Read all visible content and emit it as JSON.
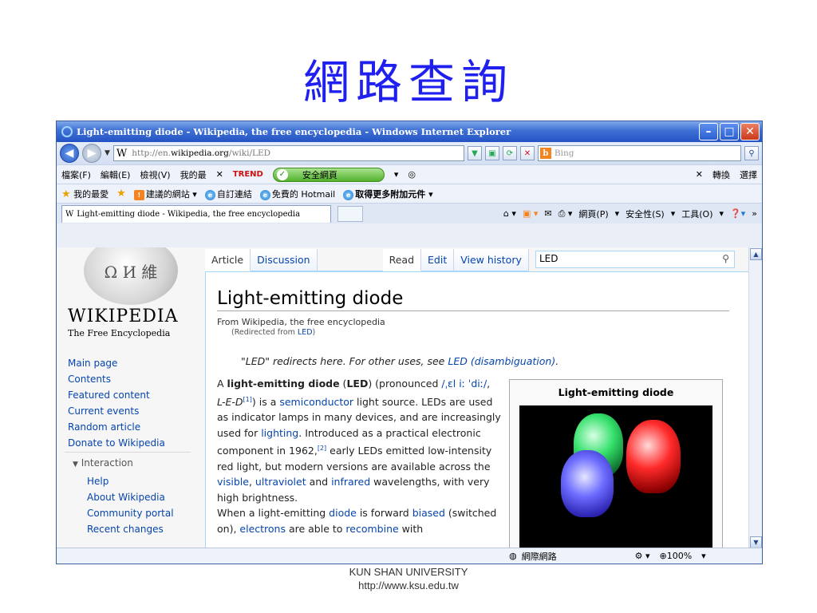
{
  "slide": {
    "title": "網路查詢",
    "footer_line1": "KUN SHAN UNIVERSITY",
    "footer_line2": "http://www.ksu.edu.tw"
  },
  "browser": {
    "window_title": "Light-emitting diode - Wikipedia, the free encyclopedia - Windows Internet Explorer",
    "address": {
      "prefix": "http://en.",
      "host": "wikipedia.org",
      "path": "/wiki/LED"
    },
    "search_placeholder": "Bing",
    "menu": {
      "file": "檔案(F)",
      "edit": "編輯(E)",
      "view": "檢視(V)",
      "favorites": "我的最",
      "trend": "TREND",
      "safe_page": "安全網頁",
      "translate": "轉換",
      "select": "選擇"
    },
    "favbar": {
      "favorites": "我的最愛",
      "suggested": "建議的網站",
      "custom_links": "自訂連結",
      "hotmail": "免費的 Hotmail",
      "more_addons": "取得更多附加元件"
    },
    "tab_label": "Light-emitting diode - Wikipedia, the free encyclopedia",
    "commands": {
      "page": "網頁(P)",
      "safety": "安全性(S)",
      "tools": "工具(O)"
    },
    "status": {
      "zone": "網際網路",
      "zoom": "100%"
    }
  },
  "wikipedia": {
    "wordmark": "WIKIPEDIA",
    "tagline": "The Free Encyclopedia",
    "nav": [
      "Main page",
      "Contents",
      "Featured content",
      "Current events",
      "Random article",
      "Donate to Wikipedia"
    ],
    "interaction_heading": "Interaction",
    "interaction": [
      "Help",
      "About Wikipedia",
      "Community portal",
      "Recent changes"
    ],
    "tabs": {
      "article": "Article",
      "discussion": "Discussion",
      "read": "Read",
      "edit": "Edit",
      "history": "View history"
    },
    "search_value": "LED",
    "article": {
      "title": "Light-emitting diode",
      "from": "From Wikipedia, the free encyclopedia",
      "redirect_prefix": "(Redirected from ",
      "redirect_link": "LED",
      "redirect_suffix": ")",
      "hatnote_text": "\"LED\" redirects here. For other uses, see ",
      "hatnote_link": "LED (disambiguation)",
      "hatnote_end": ".",
      "infobox_title": "Light-emitting diode"
    }
  }
}
